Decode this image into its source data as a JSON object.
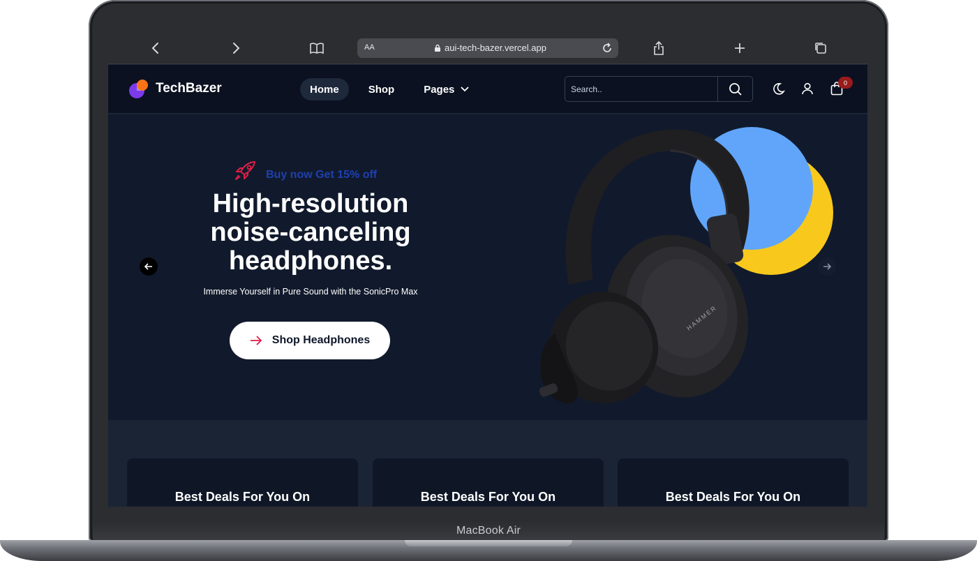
{
  "device": {
    "label": "MacBook Air"
  },
  "browser": {
    "url": "aui-tech-bazer.vercel.app",
    "text_size_label": "AA"
  },
  "site": {
    "brand": "TechBazer",
    "nav": [
      {
        "label": "Home",
        "active": true
      },
      {
        "label": "Shop",
        "active": false
      },
      {
        "label": "Pages",
        "active": false
      }
    ],
    "search_placeholder": "Search..",
    "cart_count": "0",
    "icons": [
      "search-icon",
      "moon-icon",
      "user-icon",
      "cart-icon"
    ]
  },
  "hero": {
    "promo": "Buy now Get 15% off",
    "title": "High-resolution noise-canceling headphones.",
    "subtitle": "Immerse Yourself in Pure Sound with the SonicPro Max",
    "cta": "Shop Headphones",
    "product_brand": "HAMMER"
  },
  "deals": [
    {
      "title": "Best Deals For You On"
    },
    {
      "title": "Best Deals For You On"
    },
    {
      "title": "Best Deals For You On"
    }
  ],
  "colors": {
    "accent_red": "#e11d48",
    "promo_blue": "#1e40af",
    "circle_blue": "#60a5fa",
    "circle_yellow": "#f8c91c",
    "hero_bg": "#111a2c",
    "header_bg": "#0b1120"
  }
}
